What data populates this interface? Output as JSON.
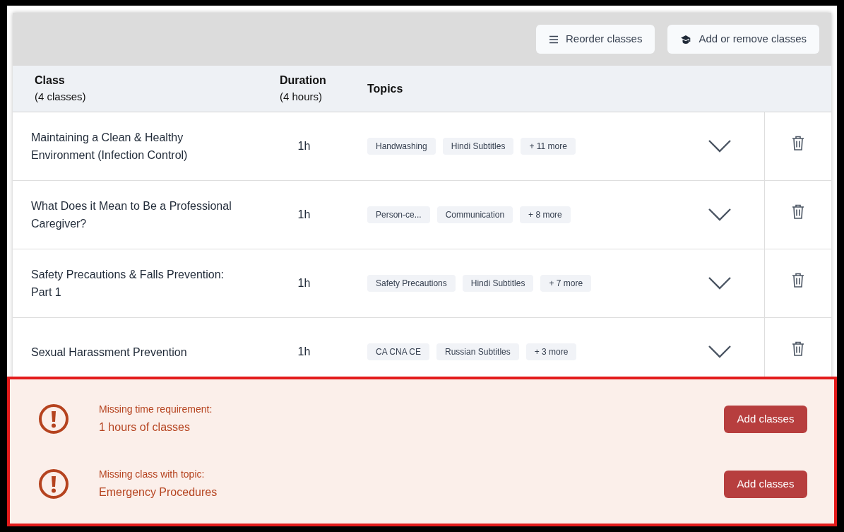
{
  "toolbar": {
    "buttons": [
      {
        "kind": "reorder",
        "label": "Reorder classes"
      },
      {
        "kind": "add-remove",
        "label": "Add or remove classes"
      }
    ]
  },
  "table": {
    "columns": [
      {
        "title": "Class",
        "subtitle": "(4 classes)"
      },
      {
        "title": "Duration",
        "subtitle": "(4 hours)"
      },
      {
        "title": "Topics"
      }
    ],
    "rows": [
      {
        "name": "Maintaining a Clean & Healthy Environment (Infection Control)",
        "duration": "1h",
        "topics": [
          "Handwashing",
          "Hindi Subtitles",
          "+ 11 more"
        ],
        "expanded": false
      },
      {
        "name": "What Does it Mean to Be a Professional Caregiver?",
        "duration": "1h",
        "topics": [
          "Person-ce...",
          "Communication",
          "+ 8 more"
        ],
        "expanded": false
      },
      {
        "name": "Safety Precautions & Falls Prevention: Part 1",
        "duration": "1h",
        "topics": [
          "Safety Precautions",
          "Hindi Subtitles",
          "+ 7 more"
        ],
        "expanded": false
      },
      {
        "name": "Sexual Harassment Prevention",
        "duration": "1h",
        "topics": [
          "CA CNA CE",
          "Russian Subtitles",
          "+ 3 more"
        ],
        "expanded": false
      }
    ]
  },
  "alerts": [
    {
      "label": "Missing time requirement:",
      "value": "1 hours of classes",
      "button": "Add classes"
    },
    {
      "label": "Missing class with topic:",
      "value": "Emergency Procedures",
      "button": "Add classes"
    }
  ]
}
